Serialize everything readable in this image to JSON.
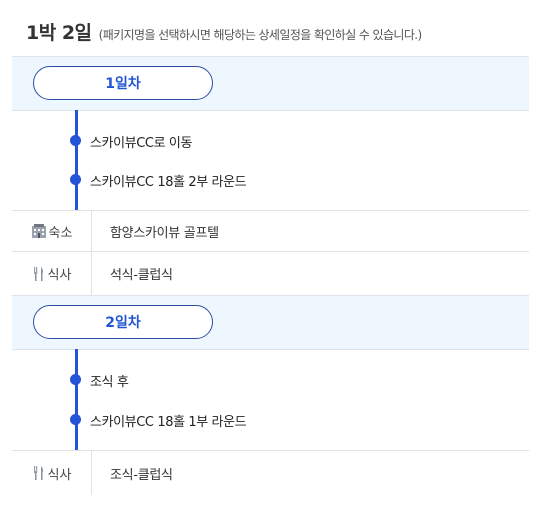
{
  "header": {
    "duration": "1박 2일",
    "guide": "(패키지명을 선택하시면 해당하는 상세일정을 확인하실 수 있습니다.)"
  },
  "days": [
    {
      "label": "1일차",
      "items": [
        "스카이뷰CC로 이동",
        "스카이뷰CC 18홀 2부 라운드"
      ],
      "info": [
        {
          "icon": "hotel-icon",
          "label": "숙소",
          "value": "함양스카이뷰 골프텔"
        },
        {
          "icon": "utensils-icon",
          "label": "식사",
          "value": "석식-클럽식"
        }
      ]
    },
    {
      "label": "2일차",
      "items": [
        "조식 후",
        "스카이뷰CC 18홀 1부 라운드"
      ],
      "info": [
        {
          "icon": "utensils-icon",
          "label": "식사",
          "value": "조식-클럽식"
        }
      ]
    }
  ],
  "colors": {
    "accent": "#2553d8",
    "band": "#eef6fe",
    "pill_border": "#2c4ea3"
  }
}
